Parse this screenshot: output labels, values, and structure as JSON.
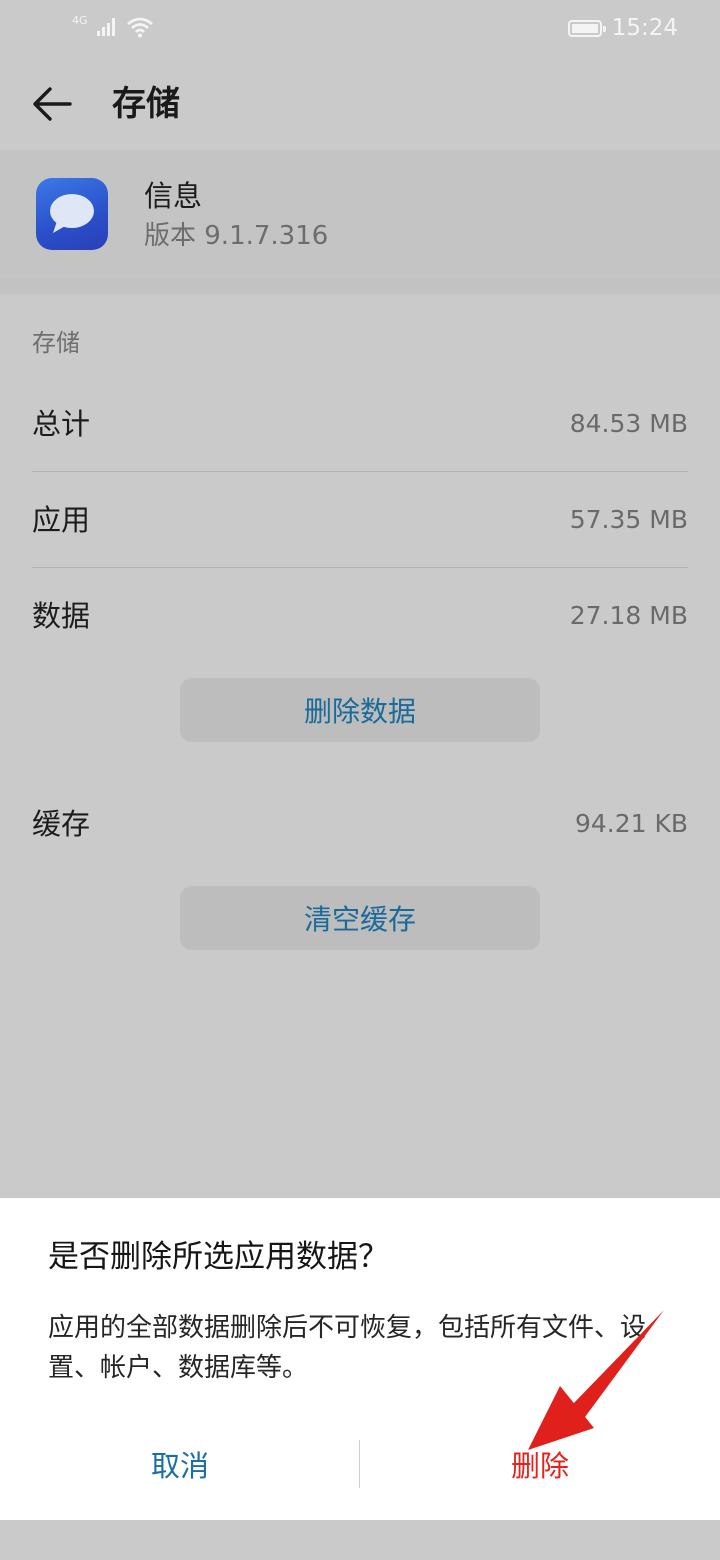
{
  "status_bar": {
    "network": "4G",
    "time": "15:24",
    "icons": [
      "signal-icon",
      "wifi-icon",
      "battery-icon"
    ]
  },
  "header": {
    "title": "存储",
    "back_icon": "arrow-left-icon"
  },
  "app": {
    "name": "信息",
    "version": "版本 9.1.7.316",
    "icon": "message-bubble-icon"
  },
  "storage": {
    "section_label": "存储",
    "rows": [
      {
        "label": "总计",
        "value": "84.53 MB"
      },
      {
        "label": "应用",
        "value": "57.35 MB"
      },
      {
        "label": "数据",
        "value": "27.18 MB"
      },
      {
        "label": "缓存",
        "value": "94.21 KB"
      }
    ],
    "clear_data_label": "删除数据",
    "clear_cache_label": "清空缓存"
  },
  "dialog": {
    "title": "是否删除所选应用数据？",
    "body": "应用的全部数据删除后不可恢复，包括所有文件、设置、帐户、数据库等。",
    "cancel_label": "取消",
    "delete_label": "删除"
  },
  "colors": {
    "accent_blue": "#1a6fa3",
    "delete_red": "#e3231c",
    "annotation_arrow": "#e0201a"
  }
}
